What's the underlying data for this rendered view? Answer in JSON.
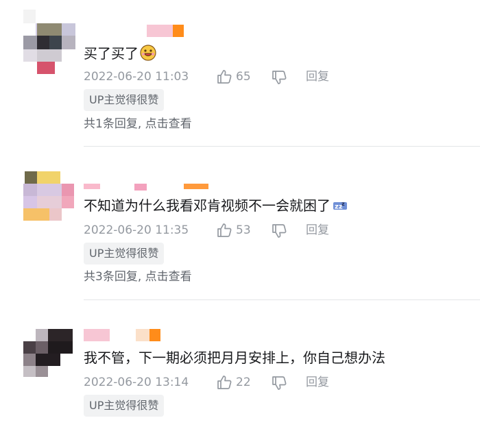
{
  "comments": [
    {
      "text": "买了买了",
      "emoji": "grinning-emoji",
      "time": "2022-06-20 11:03",
      "likes": "65",
      "reply_label": "回复",
      "badge": "UP主觉得很赞",
      "replies_summary": "共1条回复, 点击查看"
    },
    {
      "text": "不知道为什么我看邓肯视频不一会就困了",
      "emoji": "sleepy-zzz-emoji",
      "time": "2022-06-20 11:35",
      "likes": "53",
      "reply_label": "回复",
      "badge": "UP主觉得很赞",
      "replies_summary": "共3条回复, 点击查看"
    },
    {
      "text": "我不管，下一期必须把月月安排上，你自己想办法",
      "time": "2022-06-20 13:14",
      "likes": "22",
      "reply_label": "回复",
      "badge": "UP主觉得很赞"
    }
  ],
  "colors": {
    "meta_gray": "#9499a0",
    "badge_bg": "#f1f2f3",
    "divider": "#e3e5e7",
    "username_pink": "#fb7299",
    "vip_orange": "#ff8c1a"
  },
  "icons": [
    "avatar-blurred",
    "thumbs-up-icon",
    "thumbs-down-icon"
  ]
}
